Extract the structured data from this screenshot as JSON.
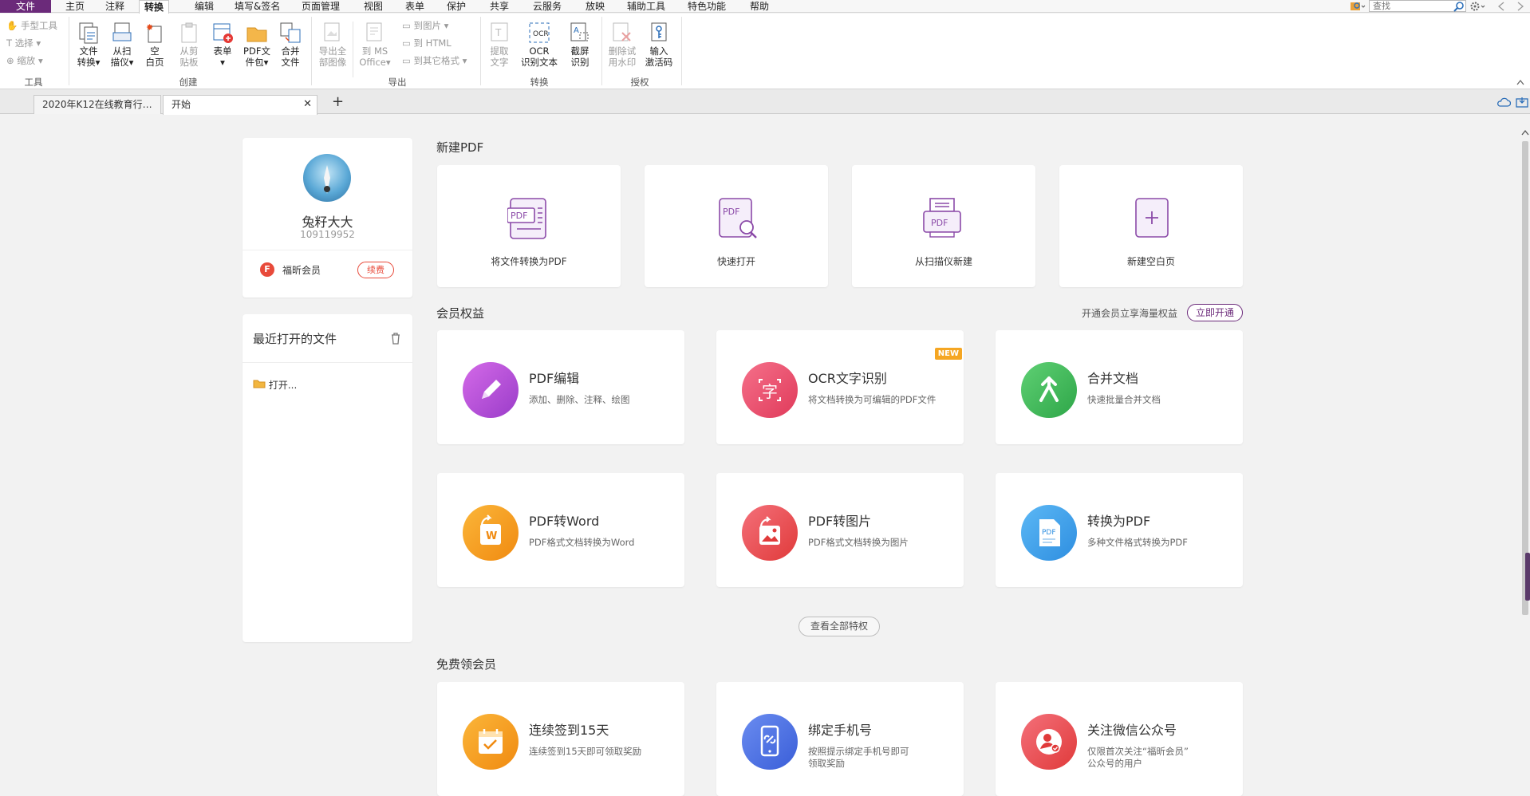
{
  "menu": {
    "items": [
      "文件",
      "主页",
      "注释",
      "转换",
      "编辑",
      "填写&签名",
      "页面管理",
      "视图",
      "表单",
      "保护",
      "共享",
      "云服务",
      "放映",
      "辅助工具",
      "特色功能",
      "帮助"
    ],
    "active_index": 3,
    "search_placeholder": "查找"
  },
  "ribbon": {
    "tools": {
      "hand": "手型工具",
      "select": "选择",
      "zoom": "缩放",
      "group": "工具"
    },
    "create": {
      "file_convert": [
        "文件",
        "转换"
      ],
      "scanner": [
        "从扫",
        "描仪"
      ],
      "blank": [
        "空",
        "白页"
      ],
      "clipboard": [
        "从剪",
        "贴板"
      ],
      "form": [
        "表单"
      ],
      "pdf_pack": [
        "PDF文",
        "件包"
      ],
      "merge": [
        "合并",
        "文件"
      ],
      "group": "创建"
    },
    "export": {
      "export_images": [
        "导出全",
        "部图像"
      ],
      "to_ms": [
        "到 MS",
        "Office"
      ],
      "to_image": "到图片",
      "to_html": "到 HTML",
      "to_other": "到其它格式",
      "group": "导出"
    },
    "convert": {
      "extract": [
        "提取",
        "文字"
      ],
      "ocr": [
        "OCR",
        "识别文本"
      ],
      "screenshot": [
        "截屏",
        "识别"
      ],
      "group": "转换"
    },
    "auth": {
      "remove_watermark": [
        "删除试",
        "用水印"
      ],
      "activation": [
        "输入",
        "激活码"
      ],
      "group": "授权"
    }
  },
  "tabs": [
    {
      "label": "2020年K12在线教育行…"
    },
    {
      "label": "开始"
    }
  ],
  "profile": {
    "name": "兔籽大大",
    "id": "109119952",
    "member_label": "福昕会员",
    "renew_label": "续费"
  },
  "recent": {
    "title": "最近打开的文件",
    "open_label": "打开..."
  },
  "new_pdf": {
    "title": "新建PDF",
    "items": [
      {
        "label": "将文件转换为PDF",
        "icon": "convert-pdf-icon"
      },
      {
        "label": "快速打开",
        "icon": "quick-open-icon"
      },
      {
        "label": "从扫描仪新建",
        "icon": "scanner-icon"
      },
      {
        "label": "新建空白页",
        "icon": "blank-page-icon"
      }
    ]
  },
  "benefits": {
    "title": "会员权益",
    "promo_text": "开通会员立享海量权益",
    "open_button": "立即开通",
    "new_badge": "NEW",
    "items": [
      {
        "title": "PDF编辑",
        "desc": "添加、删除、注释、绘图",
        "color": "#b64fd9"
      },
      {
        "title": "OCR文字识别",
        "desc": "将文档转换为可编辑的PDF文件",
        "color": "#ea4a6a"
      },
      {
        "title": "合并文档",
        "desc": "快速批量合并文档",
        "color": "#3fb65a"
      },
      {
        "title": "PDF转Word",
        "desc": "PDF格式文档转换为Word",
        "color": "#f59a1c"
      },
      {
        "title": "PDF转图片",
        "desc": "PDF格式文档转换为图片",
        "color": "#ea4a4a"
      },
      {
        "title": "转换为PDF",
        "desc": "多种文件格式转换为PDF",
        "color": "#2f9be8"
      }
    ],
    "view_all": "查看全部特权"
  },
  "free_member": {
    "title": "免费领会员",
    "items": [
      {
        "title": "连续签到15天",
        "desc": [
          "连续签到15天即可领取奖励"
        ],
        "color": "#f59a1c"
      },
      {
        "title": "绑定手机号",
        "desc": [
          "按照提示绑定手机号即可",
          "领取奖励"
        ],
        "color": "#4a6fe8"
      },
      {
        "title": "关注微信公众号",
        "desc": [
          "仅限首次关注“福昕会员”",
          "公众号的用户"
        ],
        "color": "#ea4a4a"
      }
    ]
  }
}
